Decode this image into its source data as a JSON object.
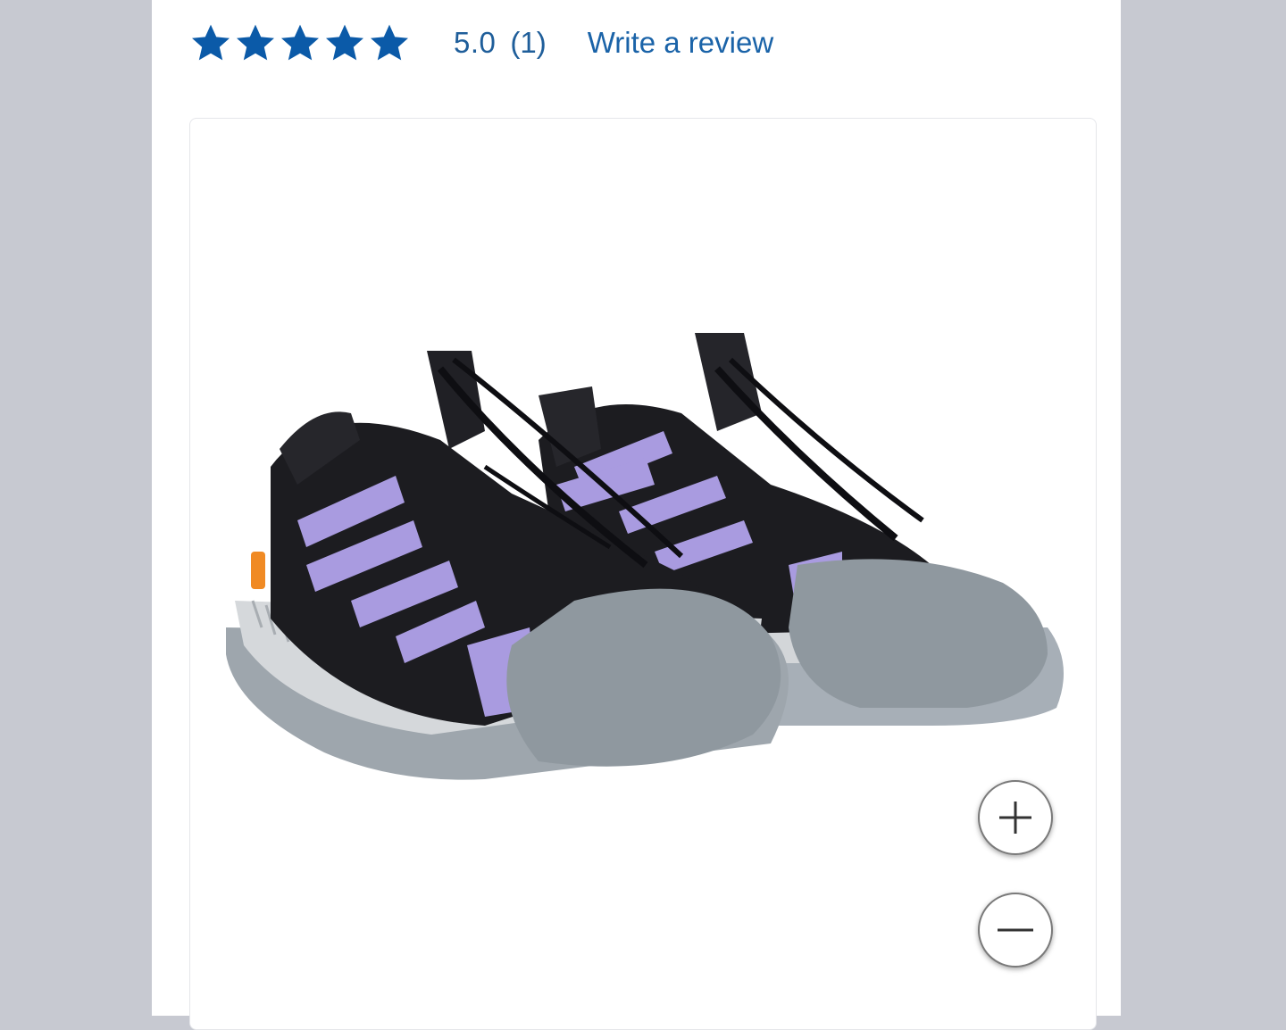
{
  "rating": {
    "stars_filled": 5,
    "stars_total": 5,
    "score": "5.0",
    "count": "(1)",
    "write_review_label": "Write a review",
    "star_color": "#0b5aa8"
  },
  "gallery": {
    "image_alt": "black and lavender closed-toe hiking sandals with grey rubber toe cap",
    "zoom_in_icon": "plus-icon",
    "zoom_out_icon": "minus-icon"
  },
  "colors": {
    "page_background": "#c7c9d1",
    "link": "#1a63a8",
    "sandal_upper": "#1c1c20",
    "sandal_straps": "#a99be0",
    "sandal_sole": "#9aa2aa"
  }
}
